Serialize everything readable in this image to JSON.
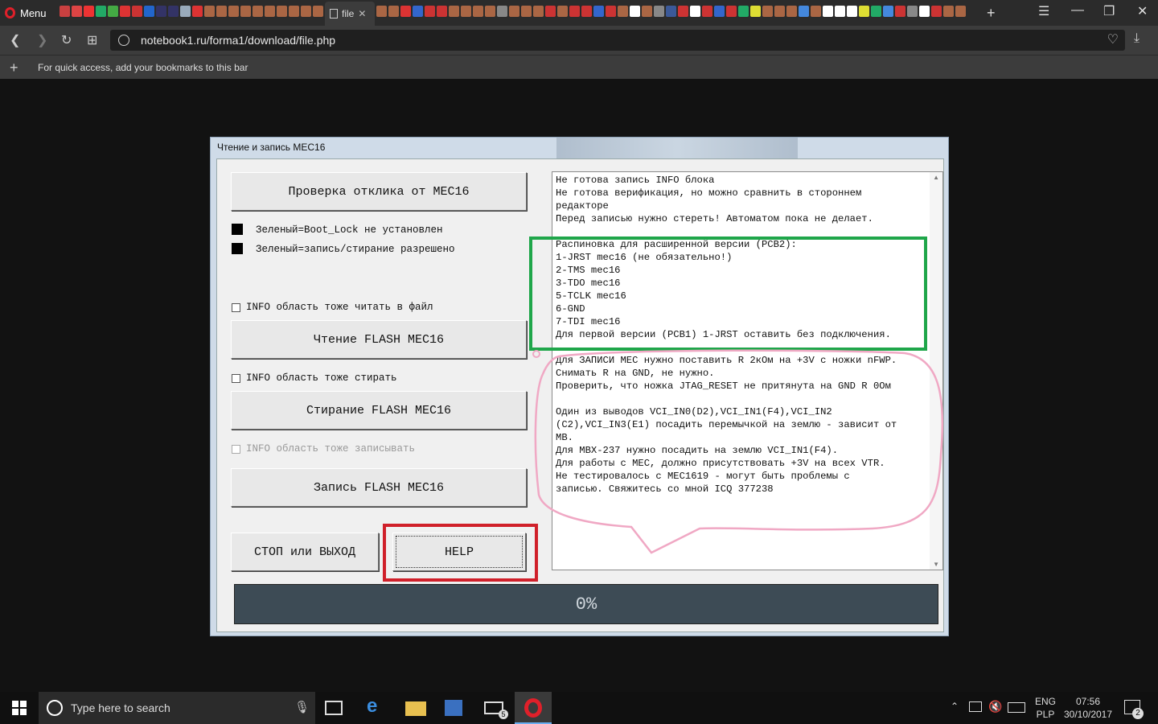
{
  "browser": {
    "menu_label": "Menu",
    "active_tab_label": "file",
    "url": "notebook1.ru/forma1/download/file.php",
    "bookmarks_hint": "For quick access, add your bookmarks to this bar",
    "tab_icon_colors_left": [
      "#c94040",
      "#d44",
      "#e33",
      "#2a6",
      "#4a4",
      "#d33",
      "#c33",
      "#2266cc",
      "#336",
      "#336",
      "#9ab",
      "#d33",
      "#a64",
      "#a64",
      "#a64",
      "#a64",
      "#a64",
      "#a64",
      "#a64",
      "#a64",
      "#a64",
      "#a64"
    ],
    "tab_icon_colors_right": [
      "#a64",
      "#a64",
      "#d33",
      "#3366cc",
      "#c33",
      "#c33",
      "#a64",
      "#a64",
      "#a64",
      "#a64",
      "#888",
      "#a64",
      "#a64",
      "#a64",
      "#c33",
      "#a64",
      "#c33",
      "#c33",
      "#3366cc",
      "#c33",
      "#a64",
      "#fff",
      "#a64",
      "#888",
      "#3b5998",
      "#c33",
      "#fff",
      "#c33",
      "#3366cc",
      "#c33",
      "#2a6",
      "#dd3",
      "#a64",
      "#a64",
      "#a64",
      "#4488dd",
      "#a64",
      "#fff",
      "#fff",
      "#fff",
      "#dd3",
      "#2a6",
      "#4488dd",
      "#c33",
      "#888",
      "#fff",
      "#c33",
      "#a64",
      "#a64"
    ]
  },
  "dialog": {
    "title": "Чтение и запись MEC16",
    "btn_check": "Проверка отклика от MEC16",
    "status_boot_lock": "Зеленый=Boot_Lock не установлен",
    "status_write_allowed": "Зеленый=запись/стирание разрешено",
    "cb_info_read": "INFO область тоже читать в файл",
    "btn_read": "Чтение FLASH MEC16",
    "cb_info_erase": "INFO область тоже стирать",
    "btn_erase": "Стирание FLASH MEC16",
    "cb_info_write": "INFO область тоже записывать",
    "btn_write": "Запись FLASH MEC16",
    "btn_stop": "СТОП или ВЫХОД",
    "btn_help": "HELP",
    "progress": "0%",
    "memo_lines": [
      "Не готова запись INFO блока",
      "Не готова верификация, но можно сравнить в стороннем",
      "редакторе",
      "Перед записью нужно стереть! Автоматом пока не делает.",
      "",
      "Распиновка для расширенной версии (PCB2):",
      "1-JRST mec16 (не обязательно!)",
      "2-TMS mec16",
      "3-TDO mec16",
      "5-TCLK mec16",
      "6-GND",
      "7-TDI mec16",
      "Для первой версии (PCB1) 1-JRST оставить без подключения.",
      "",
      "Для ЗАПИСИ MEC нужно поставить R 2кОм на +3V с ножки nFWP.",
      "Снимать R на GND, не нужно.",
      "Проверить, что ножка JTAG_RESET не притянута на GND R 0Ом",
      "",
      "Один из выводов VCI_IN0(D2),VCI_IN1(F4),VCI_IN2",
      "(C2),VCI_IN3(E1) посадить перемычкой на землю - зависит от",
      "MB.",
      "Для MBX-237 нужно посадить на землю VCI_IN1(F4).",
      "Для работы с MEC, должно присутствовать +3V на всех VTR.",
      "Не тестировалось с MEC1619 - могут быть проблемы с",
      "записью. Свяжитесь со мной ICQ 377238"
    ]
  },
  "taskbar": {
    "search_placeholder": "Type here to search",
    "mail_badge": "5",
    "lang_top": "ENG",
    "lang_bottom": "PLP",
    "time": "07:56",
    "date": "30/10/2017",
    "notifications": "2"
  },
  "annotation_colors": {
    "green": "#1fa64a",
    "red": "#d0202a",
    "pink": "#f0a8c4"
  }
}
